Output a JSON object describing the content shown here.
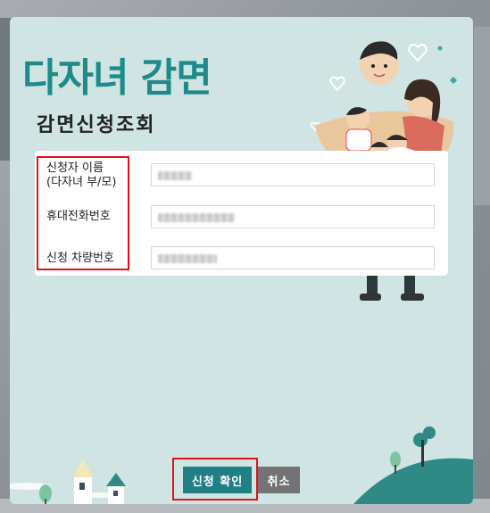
{
  "modal": {
    "title": "다자녀 감면",
    "subtitle": "감면신청조회"
  },
  "form": {
    "fields": [
      {
        "label_line1": "신청자 이름",
        "label_line2": "(다자녀 부/모)",
        "value": ""
      },
      {
        "label_line1": "휴대전화번호",
        "label_line2": "",
        "value": ""
      },
      {
        "label_line1": "신청 차량번호",
        "label_line2": "",
        "value": ""
      }
    ]
  },
  "buttons": {
    "confirm_label": "신청 확인",
    "cancel_label": "취소"
  },
  "colors": {
    "brand_teal": "#1e8a8a",
    "modal_background": "#cfe4e3",
    "highlight_red": "#e0121b",
    "cancel_gray": "#737373"
  },
  "icons": [
    "family-illustration",
    "house-icon",
    "tree-icon",
    "heart-icon"
  ]
}
